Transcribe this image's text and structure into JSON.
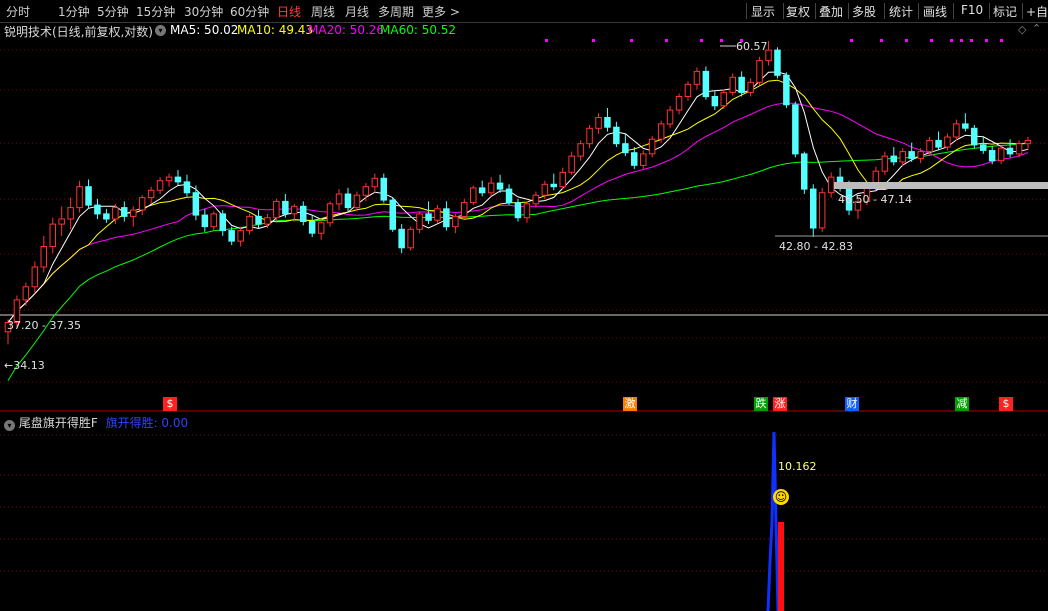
{
  "toolbar": {
    "periods": [
      "分时",
      "1分钟",
      "5分钟",
      "15分钟",
      "30分钟",
      "60分钟",
      "日线",
      "周线",
      "月线",
      "多周期",
      "更多 >"
    ],
    "active_period": "日线",
    "right_items": [
      "显示",
      "复权",
      "叠加",
      "多股",
      "统计",
      "画线",
      "F10",
      "标记",
      "+自选"
    ]
  },
  "indicator_header": {
    "name": "锐明技术",
    "mode": "(日线,前复权,对数)",
    "ma5_label": "MA5: 50.02",
    "ma10_label": "MA10: 49.43",
    "ma20_label": "MA20: 50.26",
    "ma60_label": "MA60: 50.52"
  },
  "price_notes": {
    "high": "60.57",
    "range1": "46.50 - 47.14",
    "range2": "42.80 - 42.83",
    "range3": "37.20 - 37.35",
    "low": "34.13"
  },
  "signals": [
    {
      "label": "$",
      "color": "#ff2020"
    },
    {
      "label": "激",
      "color": "#ff7a00"
    },
    {
      "label": "跌",
      "color": "#00a000"
    },
    {
      "label": "涨",
      "color": "#ff2020"
    },
    {
      "label": "财",
      "color": "#1060ff"
    },
    {
      "label": "减",
      "color": "#00a000"
    },
    {
      "label": "$",
      "color": "#ff2020"
    }
  ],
  "sub_indicator": {
    "name": "尾盘旗开得胜F",
    "value_label": "旗开得胜: 0.00",
    "peak_value": "10.162"
  },
  "colors": {
    "up": "#ff3232",
    "down": "#54ffff",
    "ma5": "#ffffff",
    "ma10": "#ffff00",
    "ma20": "#ff00ff",
    "ma60": "#00ff00",
    "grid": "#8b0000"
  },
  "chart_data": {
    "type": "candlestick",
    "title": "锐明技术 日线",
    "ylim": [
      34.13,
      60.57
    ],
    "candles": [
      [
        36.2,
        37.0,
        35.4,
        36.8
      ],
      [
        36.8,
        38.6,
        36.5,
        38.3
      ],
      [
        38.3,
        39.5,
        37.9,
        39.2
      ],
      [
        39.2,
        41.0,
        38.8,
        40.6
      ],
      [
        40.6,
        42.9,
        40.2,
        42.1
      ],
      [
        42.1,
        44.3,
        41.6,
        43.8
      ],
      [
        43.8,
        45.2,
        42.9,
        44.2
      ],
      [
        44.2,
        45.9,
        43.4,
        45.1
      ],
      [
        45.1,
        47.3,
        44.7,
        46.8
      ],
      [
        46.8,
        47.4,
        45.0,
        45.3
      ],
      [
        45.3,
        45.8,
        44.2,
        44.6
      ],
      [
        44.6,
        45.0,
        43.9,
        44.2
      ],
      [
        44.2,
        45.4,
        43.8,
        45.1
      ],
      [
        45.1,
        45.6,
        44.0,
        44.4
      ],
      [
        44.4,
        45.2,
        43.6,
        44.9
      ],
      [
        44.9,
        46.1,
        44.5,
        45.9
      ],
      [
        45.9,
        46.8,
        45.4,
        46.5
      ],
      [
        46.5,
        47.6,
        46.2,
        47.3
      ],
      [
        47.3,
        47.9,
        46.8,
        47.6
      ],
      [
        47.6,
        48.2,
        46.9,
        47.2
      ],
      [
        47.2,
        47.8,
        46.0,
        46.3
      ],
      [
        46.3,
        46.9,
        44.1,
        44.5
      ],
      [
        44.5,
        45.0,
        43.2,
        43.6
      ],
      [
        43.6,
        44.8,
        43.3,
        44.6
      ],
      [
        44.6,
        44.9,
        42.9,
        43.3
      ],
      [
        43.3,
        43.6,
        42.2,
        42.5
      ],
      [
        42.5,
        43.6,
        42.1,
        43.3
      ],
      [
        43.3,
        44.6,
        43.0,
        44.4
      ],
      [
        44.4,
        44.9,
        43.5,
        43.8
      ],
      [
        43.8,
        44.6,
        43.5,
        44.3
      ],
      [
        44.3,
        45.8,
        44.0,
        45.6
      ],
      [
        45.6,
        46.2,
        44.3,
        44.6
      ],
      [
        44.6,
        45.4,
        44.0,
        45.2
      ],
      [
        45.2,
        45.6,
        43.7,
        44.0
      ],
      [
        44.0,
        44.5,
        42.8,
        43.1
      ],
      [
        43.1,
        44.2,
        42.6,
        43.9
      ],
      [
        43.9,
        45.6,
        43.6,
        45.4
      ],
      [
        45.4,
        46.6,
        44.9,
        46.2
      ],
      [
        46.2,
        46.7,
        44.8,
        45.1
      ],
      [
        45.1,
        46.4,
        44.8,
        46.1
      ],
      [
        46.1,
        47.1,
        45.6,
        46.8
      ],
      [
        46.8,
        47.9,
        46.3,
        47.5
      ],
      [
        47.5,
        47.9,
        45.5,
        45.7
      ],
      [
        45.7,
        45.9,
        43.2,
        43.4
      ],
      [
        43.4,
        43.8,
        41.6,
        42.0
      ],
      [
        42.0,
        43.6,
        41.8,
        43.4
      ],
      [
        43.4,
        44.8,
        43.1,
        44.6
      ],
      [
        44.6,
        45.6,
        43.8,
        44.1
      ],
      [
        44.1,
        45.3,
        43.9,
        45.0
      ],
      [
        45.0,
        45.6,
        43.3,
        43.6
      ],
      [
        43.6,
        44.6,
        43.1,
        44.4
      ],
      [
        44.4,
        45.8,
        44.2,
        45.5
      ],
      [
        45.5,
        46.9,
        45.3,
        46.7
      ],
      [
        46.7,
        47.3,
        46.0,
        46.3
      ],
      [
        46.3,
        47.6,
        46.0,
        47.1
      ],
      [
        47.1,
        47.8,
        46.3,
        46.6
      ],
      [
        46.6,
        47.0,
        45.3,
        45.5
      ],
      [
        45.5,
        45.8,
        44.0,
        44.3
      ],
      [
        44.3,
        45.6,
        43.9,
        45.4
      ],
      [
        45.4,
        46.4,
        45.1,
        46.1
      ],
      [
        46.1,
        47.3,
        45.8,
        47.0
      ],
      [
        47.0,
        47.9,
        46.5,
        46.8
      ],
      [
        46.8,
        48.4,
        46.6,
        48.0
      ],
      [
        48.0,
        49.8,
        47.8,
        49.4
      ],
      [
        49.4,
        50.8,
        49.0,
        50.5
      ],
      [
        50.5,
        52.2,
        50.1,
        51.9
      ],
      [
        51.9,
        53.3,
        51.4,
        52.9
      ],
      [
        52.9,
        53.8,
        51.6,
        52.0
      ],
      [
        52.0,
        52.5,
        50.2,
        50.5
      ],
      [
        50.5,
        51.4,
        49.4,
        49.7
      ],
      [
        49.7,
        50.2,
        48.3,
        48.6
      ],
      [
        48.6,
        49.9,
        48.3,
        49.6
      ],
      [
        49.6,
        51.2,
        49.3,
        50.9
      ],
      [
        50.9,
        52.6,
        50.6,
        52.3
      ],
      [
        52.3,
        54.0,
        51.9,
        53.6
      ],
      [
        53.6,
        55.2,
        53.2,
        54.9
      ],
      [
        54.9,
        56.4,
        54.5,
        56.1
      ],
      [
        56.1,
        57.8,
        55.6,
        57.4
      ],
      [
        57.4,
        57.9,
        54.6,
        54.9
      ],
      [
        54.9,
        55.4,
        53.6,
        54.0
      ],
      [
        54.0,
        55.6,
        53.7,
        55.3
      ],
      [
        55.3,
        57.2,
        55.0,
        56.8
      ],
      [
        56.8,
        57.4,
        54.9,
        55.3
      ],
      [
        55.3,
        56.7,
        54.9,
        56.3
      ],
      [
        56.3,
        58.9,
        56.0,
        58.5
      ],
      [
        58.5,
        60.57,
        58.0,
        59.6
      ],
      [
        59.6,
        59.9,
        56.7,
        57.0
      ],
      [
        57.0,
        57.3,
        53.8,
        54.1
      ],
      [
        54.1,
        54.4,
        49.3,
        49.6
      ],
      [
        49.6,
        49.8,
        46.2,
        46.6
      ],
      [
        46.6,
        47.0,
        42.81,
        43.5
      ],
      [
        43.5,
        46.7,
        43.2,
        46.3
      ],
      [
        46.3,
        48.0,
        45.9,
        47.6
      ],
      [
        47.6,
        48.4,
        46.4,
        46.8
      ],
      [
        46.8,
        47.3,
        44.5,
        44.9
      ],
      [
        44.9,
        45.9,
        44.2,
        45.6
      ],
      [
        45.6,
        47.2,
        45.3,
        46.9
      ],
      [
        46.9,
        48.5,
        46.6,
        48.1
      ],
      [
        48.1,
        49.8,
        47.8,
        49.4
      ],
      [
        49.4,
        50.2,
        48.6,
        48.9
      ],
      [
        48.9,
        50.1,
        48.5,
        49.8
      ],
      [
        49.8,
        50.6,
        48.9,
        49.2
      ],
      [
        49.2,
        50.1,
        48.8,
        49.8
      ],
      [
        49.8,
        51.1,
        49.5,
        50.8
      ],
      [
        50.8,
        51.6,
        49.9,
        50.2
      ],
      [
        50.2,
        51.4,
        49.9,
        51.1
      ],
      [
        51.1,
        52.7,
        50.8,
        52.3
      ],
      [
        52.3,
        53.3,
        51.6,
        51.9
      ],
      [
        51.9,
        52.2,
        50.1,
        50.4
      ],
      [
        50.4,
        51.1,
        49.6,
        49.9
      ],
      [
        49.9,
        50.3,
        48.7,
        49.0
      ],
      [
        49.0,
        50.4,
        48.7,
        50.1
      ],
      [
        50.1,
        50.9,
        49.3,
        49.6
      ],
      [
        49.6,
        50.8,
        49.3,
        50.5
      ],
      [
        50.5,
        51.1,
        50.0,
        50.8
      ]
    ]
  }
}
